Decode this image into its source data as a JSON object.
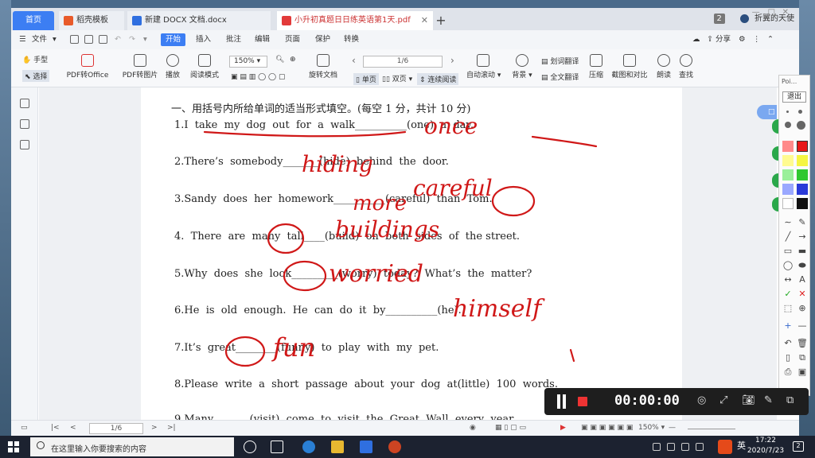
{
  "tabs": [
    {
      "label": "首页"
    },
    {
      "label": "稻壳模板"
    },
    {
      "label": "新建 DOCX 文档.docx"
    },
    {
      "label": "小升初真题日日练英语第1天.pdf"
    }
  ],
  "window_right": {
    "badge": "2",
    "user": "折翼的天使"
  },
  "menu": {
    "file": "文件",
    "start": "开始",
    "items": [
      "插入",
      "批注",
      "编辑",
      "页面",
      "保护",
      "转换"
    ],
    "share": "分享"
  },
  "ribbon": {
    "hand": "手型",
    "select": "选择",
    "pdf_to_office": "PDF转Office",
    "pdf_to_image": "PDF转图片",
    "play": "播放",
    "read_mode": "阅读模式",
    "zoom": "150%",
    "rotate": "旋转文档",
    "single": "单页",
    "double": "双页",
    "continuous": "连续阅读",
    "page": "1/6",
    "auto_scroll": "自动滚动",
    "background": "背景",
    "word_translate": "划词翻译",
    "full_translate": "全文翻译",
    "compress": "压缩",
    "screenshot_compare": "截图和对比",
    "read_aloud": "朗读",
    "find": "查找"
  },
  "document": {
    "heading": "一、用括号内所给单词的适当形式填空。(每空 1 分，共计 10 分)",
    "lines": [
      "1.I  take  my  dog  out  for  a  walk__________(one)  a  day.",
      "2.There’s  somebody_______(hide)  behind  the  door.",
      "3.Sandy  does  her  homework__________(careful)  than  Tom.",
      "4.  There  are  many  tall____(build)  on  both  sides  of  the street.",
      "5.Why  does  she  look_________(worry)  today?  What’s  the  matter?",
      "6.He  is  old  enough.  He  can  do  it  by__________(he).",
      "7.It’s  great________(funny)  to  play  with  my  pet.",
      "8.Please  write  a  short  passage  about  your  dog  at(little)  100  words.",
      "9.Many_______(visit)  come  to  visit  the  Great  Wall  every  year."
    ],
    "handwriting": [
      "once",
      "hiding",
      "careful",
      "more",
      "buildings",
      "worried",
      "himself",
      "fun"
    ],
    "side_pill": "□"
  },
  "pen_toolbar": {
    "title": "Poi...",
    "exit": "退出",
    "colors": [
      "#e81818",
      "#f5f542",
      "#30c830",
      "#2a3ad8",
      "#111111",
      "#ff8a8a",
      "#fffb90",
      "#9af09a",
      "#9aa8ff",
      "#ffffff"
    ]
  },
  "recorder": {
    "time": "00:00:00"
  },
  "statusbar": {
    "page": "1/6",
    "zoom": "150%"
  },
  "taskbar": {
    "search_placeholder": "在这里输入你要搜索的内容",
    "ime": "英",
    "time": "17:22",
    "date": "2020/7/23",
    "notifications": "2"
  }
}
